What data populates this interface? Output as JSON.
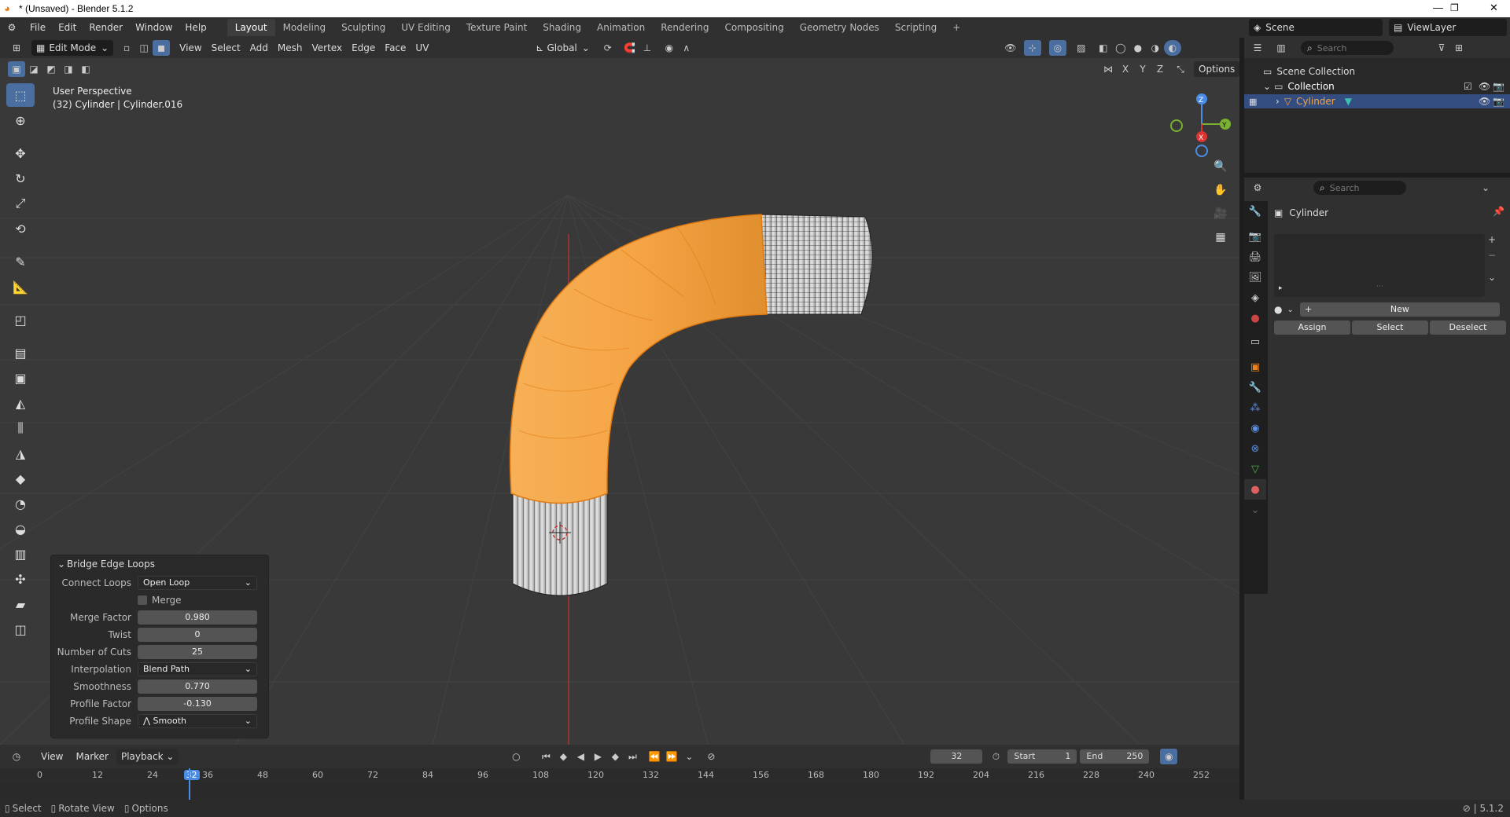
{
  "window": {
    "title": "* (Unsaved) - Blender 5.1.2"
  },
  "menu": [
    "File",
    "Edit",
    "Render",
    "Window",
    "Help"
  ],
  "workspaces": [
    "Layout",
    "Modeling",
    "Sculpting",
    "UV Editing",
    "Texture Paint",
    "Shading",
    "Animation",
    "Rendering",
    "Compositing",
    "Geometry Nodes",
    "Scripting"
  ],
  "active_workspace": "Layout",
  "scene": {
    "label": "Scene",
    "viewlayer": "ViewLayer"
  },
  "viewport_header": {
    "mode": "Edit Mode",
    "menus": [
      "View",
      "Select",
      "Add",
      "Mesh",
      "Vertex",
      "Edge",
      "Face",
      "UV"
    ],
    "orientation": "Global",
    "axes": [
      "X",
      "Y",
      "Z"
    ],
    "options": "Options"
  },
  "viewport_info": {
    "line1": "User Perspective",
    "line2": "(32) Cylinder | Cylinder.016"
  },
  "gizmo": {
    "z": "Z",
    "y": "Y",
    "x": "X"
  },
  "operator_panel": {
    "title": "Bridge Edge Loops",
    "connect_loops_label": "Connect Loops",
    "connect_loops": "Open Loop",
    "merge_label": "Merge",
    "merge_factor_label": "Merge Factor",
    "merge_factor": "0.980",
    "twist_label": "Twist",
    "twist": "0",
    "cuts_label": "Number of Cuts",
    "cuts": "25",
    "interp_label": "Interpolation",
    "interp": "Blend Path",
    "smooth_label": "Smoothness",
    "smooth": "0.770",
    "profile_factor_label": "Profile Factor",
    "profile_factor": "-0.130",
    "profile_shape_label": "Profile Shape",
    "profile_shape": "Smooth"
  },
  "outliner": {
    "search_placeholder": "Search",
    "scene_collection": "Scene Collection",
    "collection": "Collection",
    "object": "Cylinder"
  },
  "properties": {
    "search_placeholder": "Search",
    "object_name": "Cylinder",
    "new": "New",
    "assign": "Assign",
    "select": "Select",
    "deselect": "Deselect"
  },
  "timeline": {
    "menus": [
      "View",
      "Marker",
      "Playback"
    ],
    "current_frame": "32",
    "start_label": "Start",
    "start": "1",
    "end_label": "End",
    "end": "250",
    "ticks": [
      "0",
      "12",
      "24",
      "32",
      "36",
      "48",
      "60",
      "72",
      "84",
      "96",
      "108",
      "120",
      "132",
      "144",
      "156",
      "168",
      "180",
      "192",
      "204",
      "216",
      "228",
      "240",
      "252"
    ]
  },
  "statusbar": {
    "select": "Select",
    "rotate": "Rotate View",
    "options": "Options",
    "version": "5.1.2"
  },
  "colors": {
    "accent": "#4a6ea0",
    "selected_face": "#f5a445",
    "bg_viewport": "#393939"
  }
}
